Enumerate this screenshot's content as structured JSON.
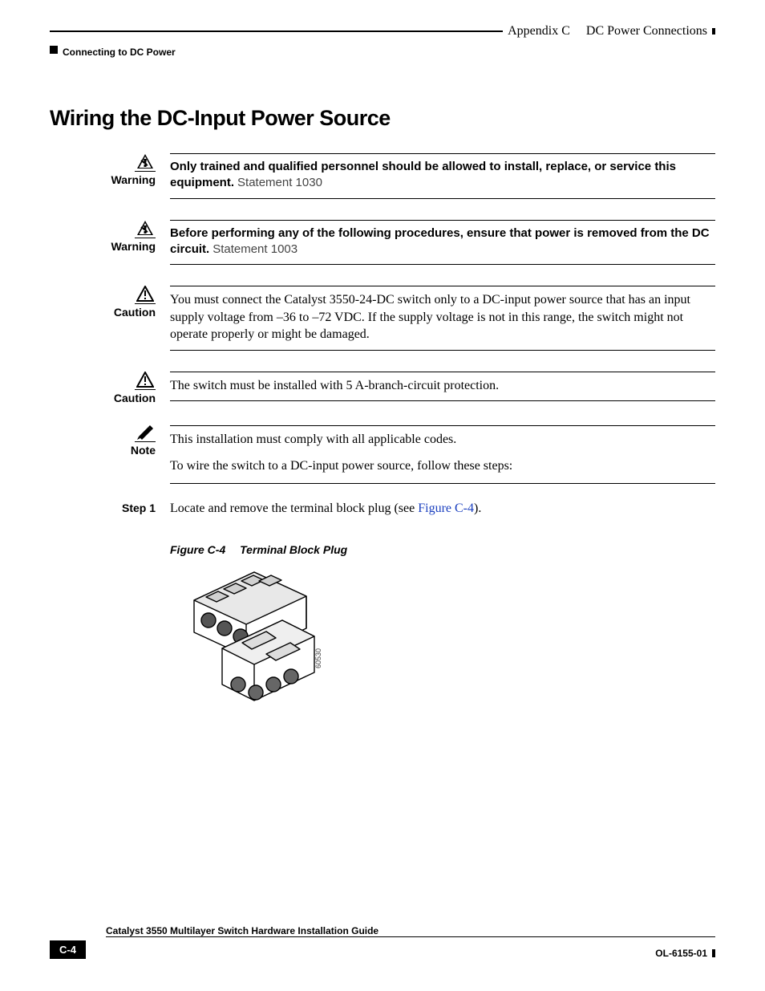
{
  "header": {
    "appendix": "Appendix C",
    "appendix_title": "DC Power Connections",
    "section": "Connecting to DC Power"
  },
  "title": "Wiring the DC-Input Power Source",
  "warnings": [
    {
      "label": "Warning",
      "bold": "Only trained and qualified personnel should be allowed to install, replace, or service this equipment.",
      "aux": "Statement 1030"
    },
    {
      "label": "Warning",
      "bold": "Before performing any of the following procedures, ensure that power is removed from the DC circuit.",
      "aux": "Statement 1003"
    }
  ],
  "cautions": [
    {
      "label": "Caution",
      "text": "You must connect the Catalyst 3550-24-DC switch only to a DC-input power source that has an input supply voltage from –36 to –72 VDC. If the supply voltage is not in this range, the switch might not operate properly or might be damaged."
    },
    {
      "label": "Caution",
      "text": "The switch must be installed with 5 A-branch-circuit protection."
    }
  ],
  "note": {
    "label": "Note",
    "text": "This installation must comply with all applicable codes.",
    "lead": "To wire the switch to a DC-input power source, follow these steps:"
  },
  "step1": {
    "label": "Step 1",
    "text_pre": "Locate and remove the terminal block plug (see ",
    "xref": "Figure C-4",
    "text_post": ")."
  },
  "figure": {
    "num": "Figure C-4",
    "title": "Terminal Block Plug",
    "art_id": "60530"
  },
  "footer": {
    "doc_title": "Catalyst 3550 Multilayer Switch Hardware Installation Guide",
    "page": "C-4",
    "docnum": "OL-6155-01"
  }
}
